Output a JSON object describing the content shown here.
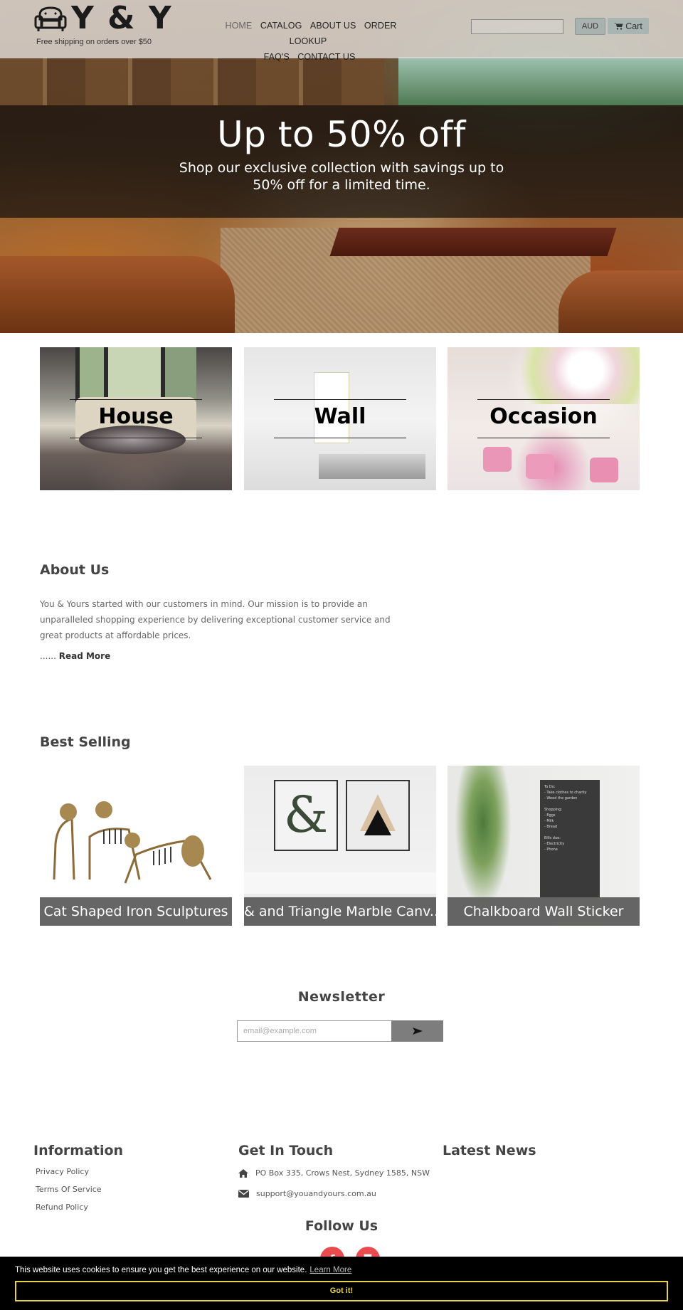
{
  "header": {
    "brand": "Y & Y",
    "tagline": "Free shipping on orders over $50",
    "nav": [
      {
        "label": "HOME",
        "active": true
      },
      {
        "label": "CATALOG"
      },
      {
        "label": "ABOUT US"
      },
      {
        "label": "ORDER LOOKUP"
      },
      {
        "label": "FAQ'S"
      },
      {
        "label": "CONTACT US"
      }
    ],
    "search": {
      "value": "",
      "placeholder": ""
    },
    "currency_label": "AUD",
    "cart_label": "Cart",
    "cart_icon": "shopping-cart-icon"
  },
  "hero": {
    "title": "Up to 50% off",
    "subtitle": "Shop our exclusive collection with savings up to 50% off for a limited time."
  },
  "categories": [
    {
      "label": "House"
    },
    {
      "label": "Wall"
    },
    {
      "label": "Occasion"
    }
  ],
  "about": {
    "title": "About Us",
    "text": "You & Yours started with our customers in mind. Our mission is to provide an unparalleled shopping experience by delivering exceptional customer service and great products at affordable prices.",
    "ellipsis": "......",
    "read_more": "Read More"
  },
  "best_selling": {
    "title": "Best Selling",
    "products": [
      {
        "name": "Cat Shaped Iron Sculptures"
      },
      {
        "name": "& and Triangle Marble Canv..."
      },
      {
        "name": "Chalkboard Wall Sticker"
      }
    ]
  },
  "newsletter": {
    "title": "Newsletter",
    "placeholder": "email@example.com",
    "submit_icon": "send-arrow-icon"
  },
  "footer": {
    "information": {
      "title": "Information",
      "links": [
        "Privacy Policy",
        "Terms Of Service",
        "Refund Policy"
      ]
    },
    "contact": {
      "title": "Get In Touch",
      "address": "PO Box 335, Crows Nest, Sydney 1585, NSW",
      "email": "support@youandyours.com.au"
    },
    "news": {
      "title": "Latest News"
    },
    "follow": {
      "title": "Follow Us",
      "networks": [
        {
          "name": "facebook",
          "glyph": "f"
        },
        {
          "name": "instagram",
          "glyph": "◘"
        }
      ]
    }
  },
  "cookie_bar": {
    "message": "This website uses cookies to ensure you get the best experience on our website.",
    "learn_more": "Learn More",
    "accept": "Got it!",
    "accent_color": "#e6d34a"
  },
  "colors": {
    "social": "#e94b4f",
    "caption_bg": "#555555",
    "heading": "#444444"
  }
}
